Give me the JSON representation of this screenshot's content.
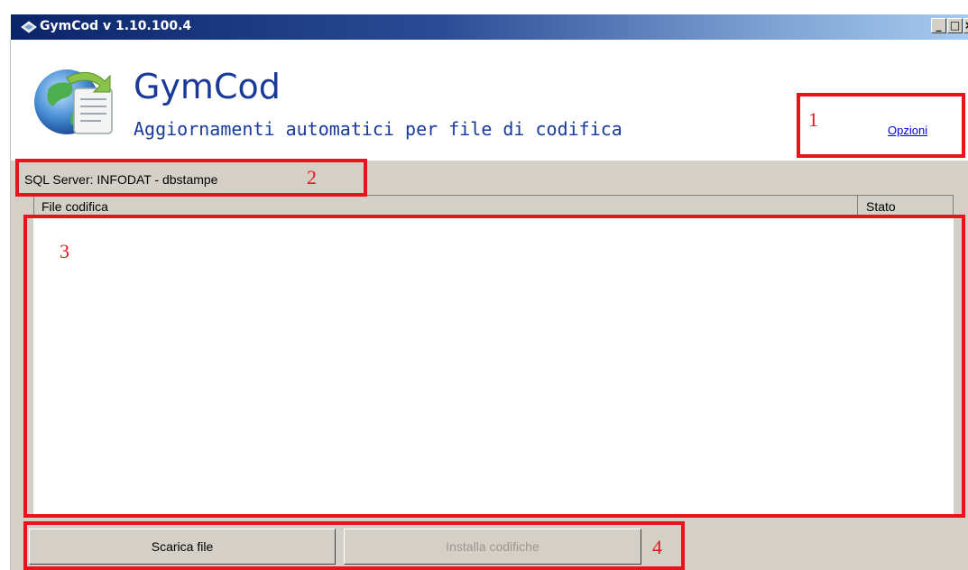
{
  "window": {
    "title": "GymCod v 1.10.100.4"
  },
  "header": {
    "app_name": "GymCod",
    "subtitle": "Aggiornamenti automatici per file di codifica",
    "options_link": "Opzioni"
  },
  "status": {
    "sql_server": "SQL Server: INFODAT - dbstampe"
  },
  "table": {
    "columns": [
      "File codifica",
      "Stato"
    ],
    "rows": []
  },
  "buttons": {
    "download": {
      "label": "Scarica file",
      "enabled": true
    },
    "install": {
      "label": "Installa codifiche",
      "enabled": false
    }
  },
  "annotations": [
    "1",
    "2",
    "3",
    "4"
  ],
  "colors": {
    "annotation": "#e8141c",
    "title_accent": "#1a3a9a",
    "link": "#0000ee"
  }
}
